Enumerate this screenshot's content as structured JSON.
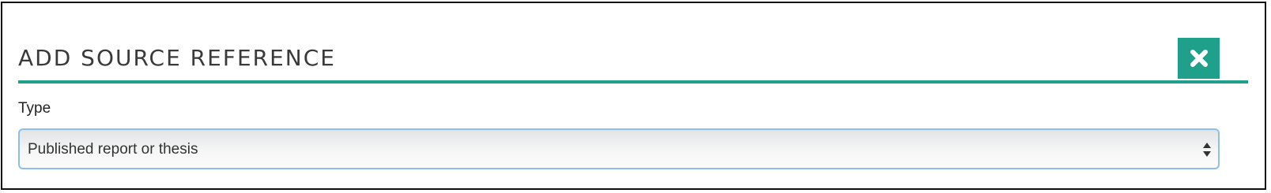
{
  "dialog": {
    "title": "ADD SOURCE REFERENCE",
    "close_icon": "close-x-icon",
    "accent_color": "#1fa08a"
  },
  "form": {
    "type_label": "Type",
    "type_select": {
      "selected_value": "Published report or thesis",
      "arrows_icon": "up-down-arrows-icon"
    }
  }
}
